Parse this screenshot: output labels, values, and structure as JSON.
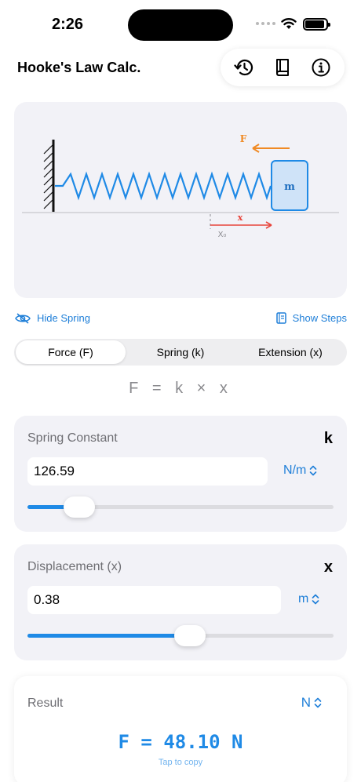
{
  "status": {
    "time": "2:26"
  },
  "header": {
    "title": "Hooke's Law Calc."
  },
  "toolbar": {
    "history_icon": "history-icon",
    "book_icon": "book-icon",
    "info_icon": "info-icon"
  },
  "diagram": {
    "force_label": "F",
    "mass_label": "m",
    "extension_label": "x",
    "origin_label": "X₀"
  },
  "links": {
    "hide_spring": "Hide Spring",
    "show_steps": "Show Steps"
  },
  "tabs": [
    {
      "label": "Force (F)",
      "active": true
    },
    {
      "label": "Spring (k)",
      "active": false
    },
    {
      "label": "Extension (x)",
      "active": false
    }
  ],
  "formula": "F = k × x",
  "spring_constant": {
    "label": "Spring Constant",
    "symbol": "k",
    "value": "126.59",
    "unit": "N/m",
    "slider_fraction": 0.17
  },
  "displacement": {
    "label": "Displacement (x)",
    "symbol": "x",
    "value": "0.38",
    "unit": "m",
    "slider_fraction": 0.53
  },
  "result": {
    "label": "Result",
    "unit": "N",
    "value": "F = 48.10 N",
    "hint": "Tap to copy"
  },
  "colors": {
    "accent": "#1f7fd8",
    "force_arrow": "#f08a24",
    "extension_arrow": "#e8453c",
    "mass_fill": "#cfe3f8"
  }
}
